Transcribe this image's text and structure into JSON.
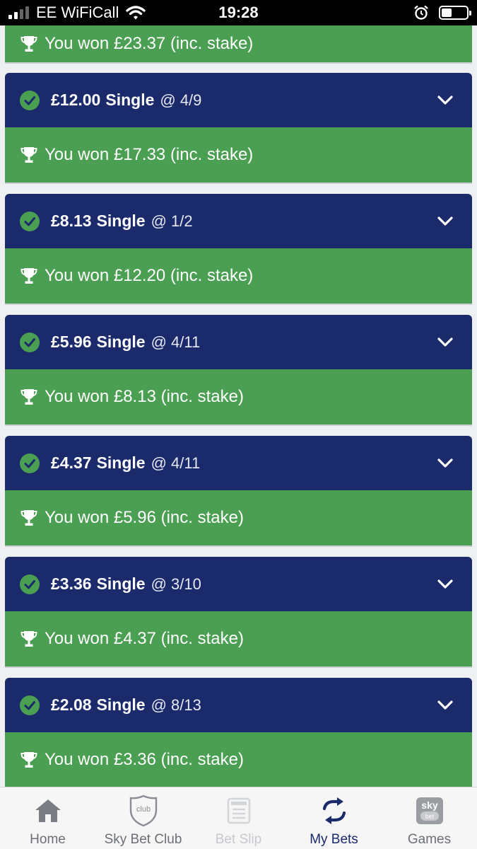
{
  "status_bar": {
    "carrier": "EE WiFiCall",
    "time": "19:28"
  },
  "first_win": {
    "text": "You won £23.37 (inc. stake)"
  },
  "bets": [
    {
      "stake": "£12.00",
      "type": "Single",
      "odds": "@ 4/9",
      "win": "You won £17.33 (inc. stake)"
    },
    {
      "stake": "£8.13",
      "type": "Single",
      "odds": "@ 1/2",
      "win": "You won £12.20 (inc. stake)"
    },
    {
      "stake": "£5.96",
      "type": "Single",
      "odds": "@ 4/11",
      "win": "You won £8.13 (inc. stake)"
    },
    {
      "stake": "£4.37",
      "type": "Single",
      "odds": "@ 4/11",
      "win": "You won £5.96 (inc. stake)"
    },
    {
      "stake": "£3.36",
      "type": "Single",
      "odds": "@ 3/10",
      "win": "You won £4.37 (inc. stake)"
    },
    {
      "stake": "£2.08",
      "type": "Single",
      "odds": "@ 8/13",
      "win": "You won £3.36 (inc. stake)"
    }
  ],
  "nav": {
    "items": [
      {
        "label": "Home",
        "icon": "home-icon",
        "state": "normal"
      },
      {
        "label": "Sky Bet Club",
        "icon": "club-shield-icon",
        "icon_text": "club",
        "state": "normal"
      },
      {
        "label": "Bet Slip",
        "icon": "betslip-icon",
        "state": "disabled"
      },
      {
        "label": "My Bets",
        "icon": "my-bets-icon",
        "state": "active"
      },
      {
        "label": "Games",
        "icon": "sky-bet-games-icon",
        "icon_text_top": "sky",
        "icon_text_bottom": "bet",
        "state": "normal"
      }
    ]
  },
  "colors": {
    "header_navy": "#1b2a6b",
    "win_green": "#4a9f52",
    "nav_active": "#1b2a6b"
  }
}
